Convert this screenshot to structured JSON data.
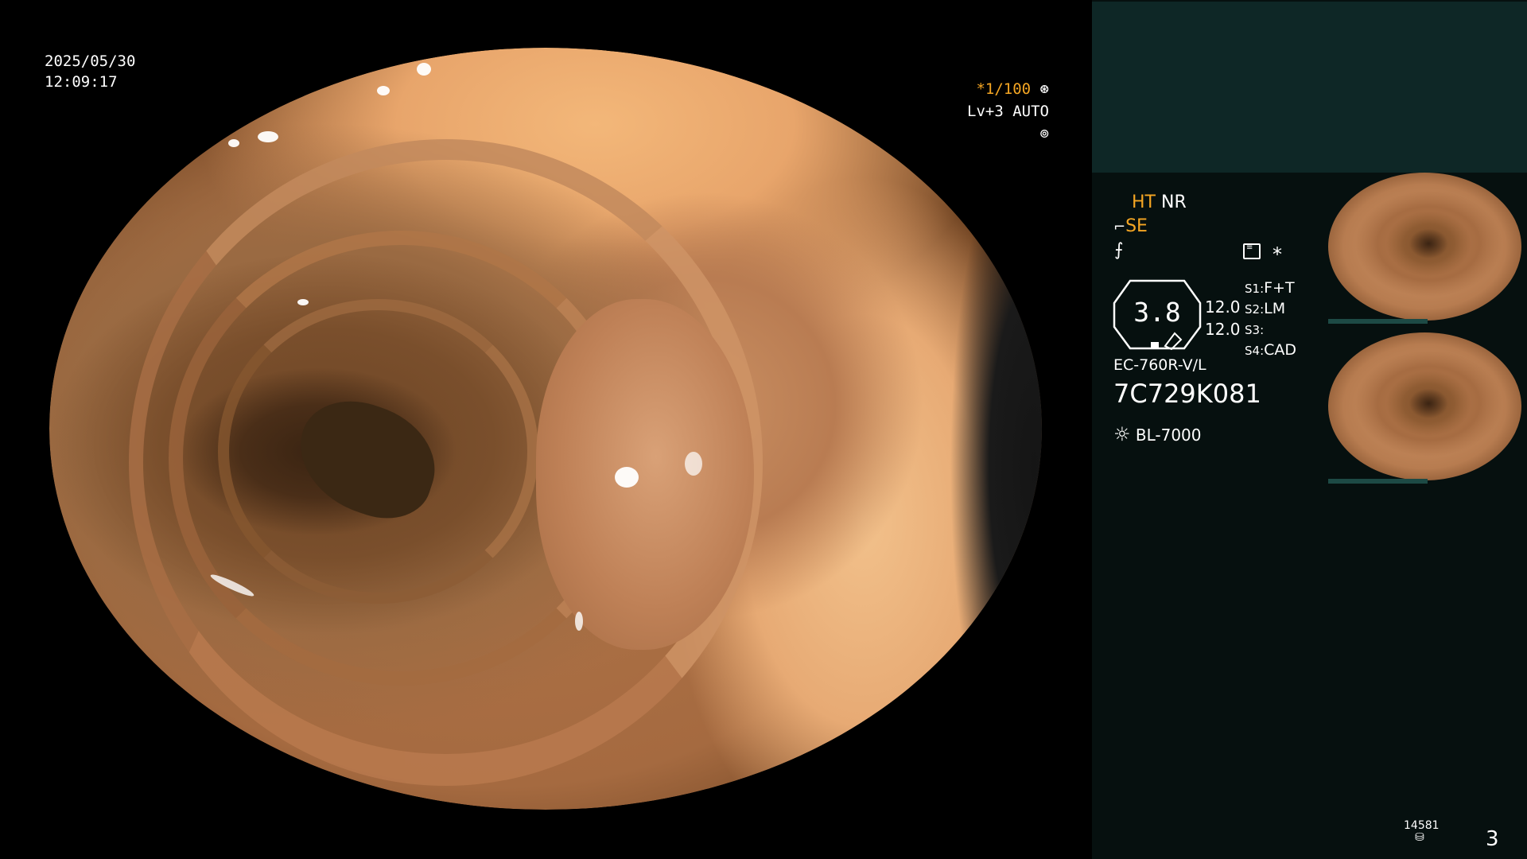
{
  "osd": {
    "date": "2025/05/30",
    "time": "12:09:17",
    "shutter": "*1/100",
    "level": "Lv+3",
    "mode": "AUTO"
  },
  "panel": {
    "ht": "HT",
    "nr": "NR",
    "se": "SE",
    "zoom_value": "3.8",
    "val_top": "12.0",
    "val_bottom": "12.0",
    "s1": "S1:",
    "s1_val": "F+T",
    "s2": "S2:",
    "s2_val": "LM",
    "s3": "S3:",
    "s3_val": "",
    "s4": "S4:",
    "s4_val": "CAD",
    "star": "*",
    "scope_model": "EC-760R-V/L",
    "serial": "7C729K081",
    "light_source": "BL-7000",
    "counter": "14581",
    "page": "3"
  },
  "colors": {
    "accent": "#f5a623",
    "panel_bg": "#06100f",
    "panel_top_bg": "#0e2726"
  },
  "icons": [
    "shutter-icon",
    "auto-iris-icon",
    "structure-enhance-icon",
    "color-enhance-icon",
    "menu-icon",
    "light-source-icon",
    "storage-icon"
  ]
}
